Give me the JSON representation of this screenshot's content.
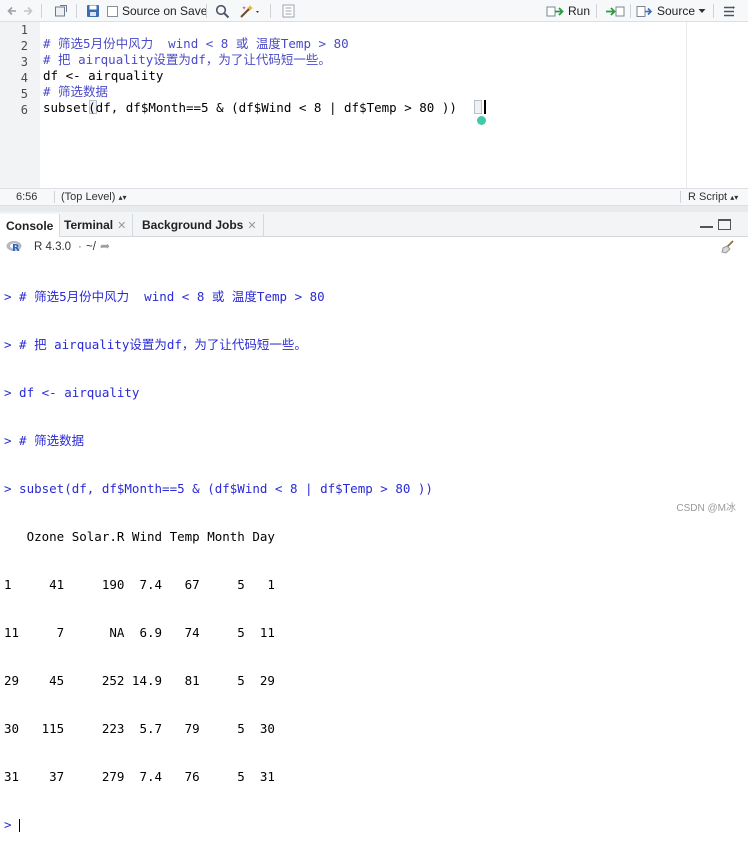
{
  "toolbar": {
    "source_on_save": "Source on Save",
    "run": "Run",
    "source": "Source"
  },
  "editor": {
    "line_numbers": [
      "1",
      "2",
      "3",
      "4",
      "5",
      "6"
    ],
    "lines": [
      "",
      "# 筛选5月份中风力  wind < 8 或 温度Temp > 80",
      "# 把 airquality设置为df，为了让代码短一些。",
      "df <- airquality",
      "# 筛选数据",
      "subset(df, df$Month==5 & (df$Wind < 8 | df$Temp > 80 ))"
    ]
  },
  "statusbar": {
    "position": "6:56",
    "scope": "(Top Level)",
    "file_type": "R Script"
  },
  "tabs": [
    {
      "label": "Console"
    },
    {
      "label": "Terminal"
    },
    {
      "label": "Background Jobs"
    }
  ],
  "console_head": {
    "r_version": "R 4.3.0",
    "path": "~/"
  },
  "console": {
    "input_lines": [
      "> # 筛选5月份中风力  wind < 8 或 温度Temp > 80",
      "> # 把 airquality设置为df，为了让代码短一些。",
      "> df <- airquality",
      "> # 筛选数据",
      "> subset(df, df$Month==5 & (df$Wind < 8 | df$Temp > 80 ))"
    ],
    "output_lines": [
      "   Ozone Solar.R Wind Temp Month Day",
      "1     41     190  7.4   67     5   1",
      "11     7      NA  6.9   74     5  11",
      "29    45     252 14.9   81     5  29",
      "30   115     223  5.7   79     5  30",
      "31    37     279  7.4   76     5  31"
    ],
    "prompt": ">"
  },
  "watermark": "CSDN @M冰",
  "colors": {
    "comment": "#4a4ac7",
    "console_input": "#2a2ad6",
    "number": "#1b1bd6"
  }
}
